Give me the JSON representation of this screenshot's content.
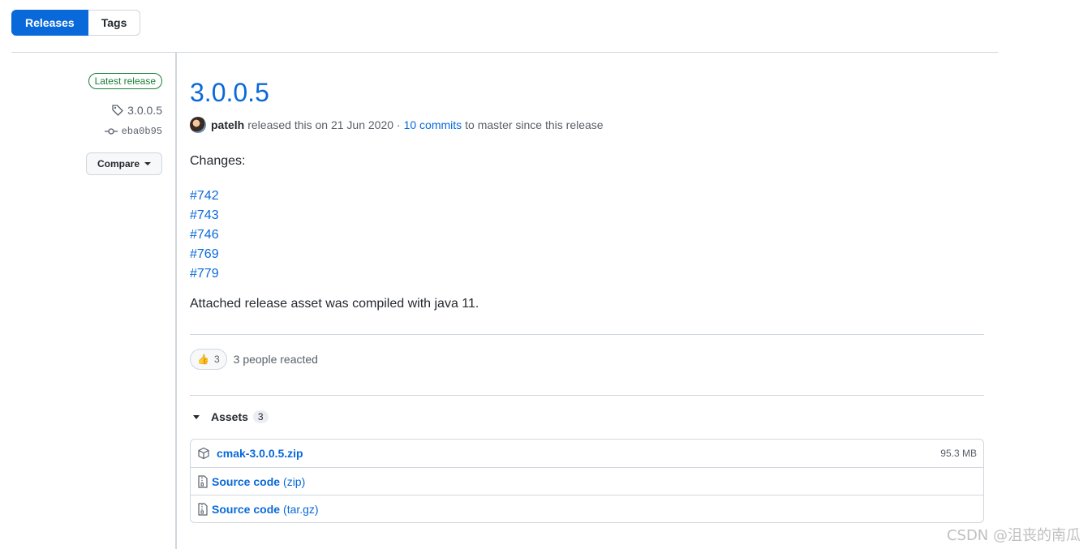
{
  "subnav": {
    "tabs": [
      {
        "label": "Releases",
        "active": true
      },
      {
        "label": "Tags",
        "active": false
      }
    ]
  },
  "sidebar": {
    "latest_badge": "Latest release",
    "tag": "3.0.0.5",
    "commit": "eba0b95",
    "compare_label": "Compare"
  },
  "release": {
    "title": "3.0.0.5",
    "author": "patelh",
    "released_text": "released this on 21 Jun 2020 ·",
    "commits_link": "10 commits",
    "commits_suffix": "to master since this release",
    "changes_heading": "Changes:",
    "issue_links": [
      "#742",
      "#743",
      "#746",
      "#769",
      "#779"
    ],
    "note": "Attached release asset was compiled with java 11."
  },
  "reactions": {
    "emoji": "👍",
    "count": "3",
    "summary": "3 people reacted"
  },
  "assets": {
    "label": "Assets",
    "count": "3",
    "items": [
      {
        "name": "cmak-3.0.0.5.zip",
        "size": "95.3 MB",
        "icon": "package-icon"
      },
      {
        "name": "Source code",
        "format": "(zip)",
        "icon": "file-zip-icon"
      },
      {
        "name": "Source code",
        "format": "(tar.gz)",
        "icon": "file-zip-icon"
      }
    ]
  },
  "watermark": "CSDN @沮丧的南瓜"
}
